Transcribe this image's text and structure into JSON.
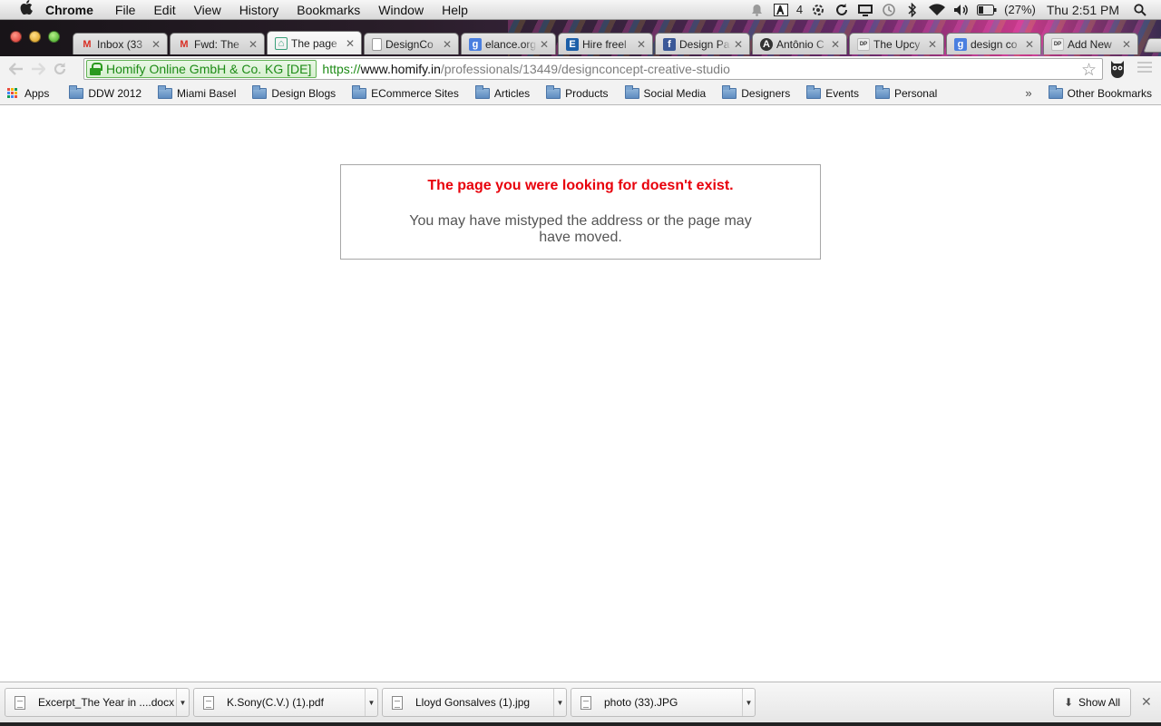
{
  "menubar": {
    "app_name": "Chrome",
    "menus": [
      "File",
      "Edit",
      "View",
      "History",
      "Bookmarks",
      "Window",
      "Help"
    ],
    "adobe_count": "4",
    "battery": "(27%)",
    "clock": "Thu 2:51 PM"
  },
  "tabs": [
    {
      "title": "Inbox (33",
      "favicon": "gmail-icon",
      "active": false
    },
    {
      "title": "Fwd: The",
      "favicon": "gmail-icon",
      "active": false
    },
    {
      "title": "The page",
      "favicon": "homify-icon",
      "active": true
    },
    {
      "title": "DesignCo",
      "favicon": "document-icon",
      "active": false
    },
    {
      "title": "elance.org",
      "favicon": "google-icon",
      "active": false
    },
    {
      "title": "Hire freel",
      "favicon": "elance-icon",
      "active": false
    },
    {
      "title": "Design Pa",
      "favicon": "facebook-icon",
      "active": false
    },
    {
      "title": "Antônio C",
      "favicon": "antonio-icon",
      "active": false
    },
    {
      "title": "The Upcy",
      "favicon": "design-pataki-icon",
      "active": false
    },
    {
      "title": "design co",
      "favicon": "google-icon",
      "active": false
    },
    {
      "title": "Add New",
      "favicon": "design-pataki-icon",
      "active": false
    }
  ],
  "toolbar": {
    "ev_org": "Homify Online GmbH & Co. KG [DE]",
    "url_scheme": "https://",
    "url_host": "www.homify.in",
    "url_path": "/professionals/13449/designconcept-creative-studio"
  },
  "bookmarks": {
    "apps_label": "Apps",
    "folders": [
      "DDW 2012",
      "Miami Basel",
      "Design Blogs",
      "ECommerce Sites",
      "Articles",
      "Products",
      "Social Media",
      "Designers",
      "Events",
      "Personal"
    ],
    "overflow": "»",
    "other": "Other Bookmarks"
  },
  "error": {
    "title": "The page you were looking for doesn't exist.",
    "message": "You may have mistyped the address or the page may have moved."
  },
  "downloads": {
    "items": [
      "Excerpt_The Year in ....docx",
      "K.Sony(C.V.) (1).pdf",
      "Lloyd Gonsalves (1).jpg",
      "photo (33).JPG"
    ],
    "show_all": "Show All"
  },
  "colors": {
    "error_red": "#e8000b",
    "ev_green": "#1d8b16"
  }
}
